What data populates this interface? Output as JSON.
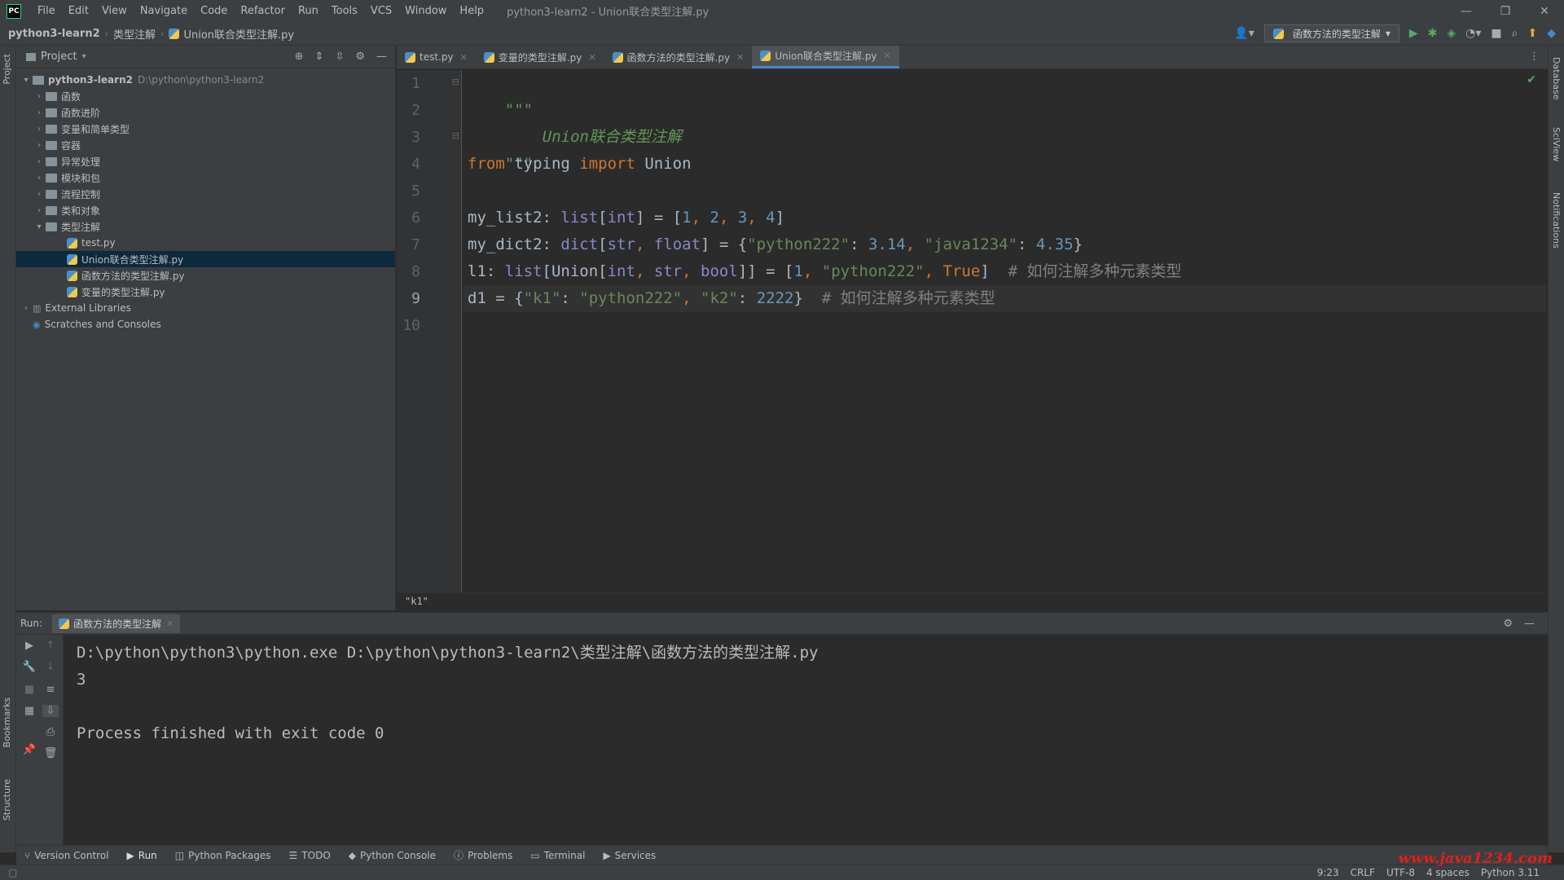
{
  "titlebar": {
    "logo": "PC",
    "menu": [
      "File",
      "Edit",
      "View",
      "Navigate",
      "Code",
      "Refactor",
      "Run",
      "Tools",
      "VCS",
      "Window",
      "Help"
    ],
    "title": "python3-learn2 - Union联合类型注解.py"
  },
  "navbar": {
    "breadcrumbs": [
      "python3-learn2",
      "类型注解",
      "Union联合类型注解.py"
    ],
    "run_config": "函数方法的类型注解"
  },
  "project": {
    "title": "Project",
    "root_name": "python3-learn2",
    "root_path": "D:\\python\\python3-learn2",
    "folders": [
      "函数",
      "函数进阶",
      "变量和简单类型",
      "容器",
      "异常处理",
      "模块和包",
      "流程控制",
      "类和对象",
      "类型注解"
    ],
    "files": [
      "test.py",
      "Union联合类型注解.py",
      "函数方法的类型注解.py",
      "变量的类型注解.py"
    ],
    "selected_file": "Union联合类型注解.py",
    "external_libraries": "External Libraries",
    "scratches": "Scratches and Consoles"
  },
  "tabs": [
    {
      "label": "test.py",
      "active": false
    },
    {
      "label": "变量的类型注解.py",
      "active": false
    },
    {
      "label": "函数方法的类型注解.py",
      "active": false
    },
    {
      "label": "Union联合类型注解.py",
      "active": true
    }
  ],
  "editor": {
    "line_numbers": [
      "1",
      "2",
      "3",
      "4",
      "5",
      "6",
      "7",
      "8",
      "9",
      "10"
    ],
    "current_line": 9,
    "docstring_open": "\"\"\"",
    "docstring_text": "Union联合类型注解",
    "docstring_close": "\"\"\"",
    "line4": {
      "from": "from",
      "module": " typing ",
      "import": "import",
      "name": " Union"
    },
    "line6": {
      "a": "my_list2: ",
      "type": "list",
      "b": "[",
      "type2": "int",
      "c": "] = [",
      "n1": "1",
      "s1": ", ",
      "n2": "2",
      "s2": ", ",
      "n3": "3",
      "s3": ", ",
      "n4": "4",
      "d": "]"
    },
    "line7": {
      "a": "my_dict2: ",
      "type": "dict",
      "b": "[",
      "t1": "str",
      "c": ", ",
      "t2": "float",
      "d": "] = {",
      "k": "\"python222\"",
      "e": ": ",
      "v": "3.14",
      "f": ", ",
      "k2": "\"java1234\"",
      "g": ": ",
      "v2": "4.35",
      "h": "}"
    },
    "line8": {
      "a": "l1: ",
      "type": "list",
      "b": "[Union[",
      "t1": "int",
      "c": ", ",
      "t2": "str",
      "d": ", ",
      "t3": "bool",
      "e": "]] = [",
      "n1": "1",
      "f": ", ",
      "s1": "\"python222\"",
      "g": ", ",
      "b1": "True",
      "h": "]  ",
      "comment": "# 如何注解多种元素类型"
    },
    "line9": {
      "a": "d1 = {",
      "k1": "\"k1\"",
      "b": ": ",
      "v1": "\"python222\"",
      "c": ", ",
      "k2": "\"k2\"",
      "d": ": ",
      "v2": "2222",
      "e": "}  ",
      "comment": "# 如何注解多种元素类型"
    },
    "breadcrumb": "\"k1\""
  },
  "run": {
    "label": "Run:",
    "tab": "函数方法的类型注解",
    "console": [
      "D:\\python\\python3\\python.exe D:\\python\\python3-learn2\\类型注解\\函数方法的类型注解.py",
      "3",
      "",
      "Process finished with exit code 0"
    ]
  },
  "tooltabs": [
    "Version Control",
    "Run",
    "Python Packages",
    "TODO",
    "Python Console",
    "Problems",
    "Terminal",
    "Services"
  ],
  "stripes": {
    "left": [
      "Project",
      "Bookmarks",
      "Structure"
    ],
    "right": [
      "Database",
      "SciView",
      "Notifications"
    ]
  },
  "status": {
    "position": "9:23",
    "line_sep": "CRLF",
    "encoding": "UTF-8",
    "indent": "4 spaces",
    "interpreter": "Python 3.11"
  },
  "watermark": "www.java1234.com"
}
